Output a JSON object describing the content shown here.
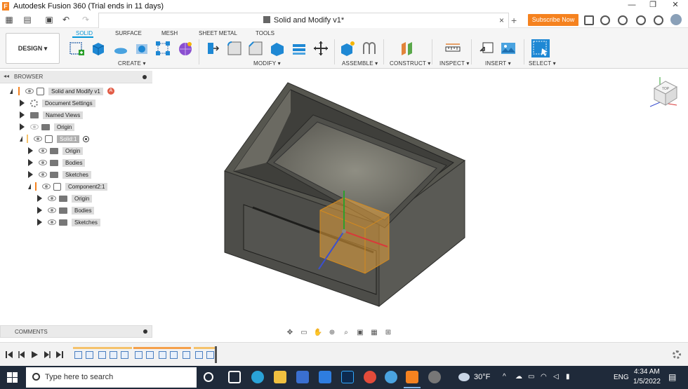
{
  "window": {
    "title": "Autodesk Fusion 360 (Trial ends in 11 days)",
    "logo_letter": "F",
    "minimize": "—",
    "restore": "❐",
    "close": "✕"
  },
  "document_tab": {
    "title": "Solid and Modify v1*",
    "close": "×",
    "new_tab": "+"
  },
  "header": {
    "subscribe_label": "Subscribe Now"
  },
  "toolbar": {
    "workspace": "DESIGN ▾",
    "tabs": [
      "SOLID",
      "SURFACE",
      "MESH",
      "SHEET METAL",
      "TOOLS"
    ],
    "groups": [
      "CREATE ▾",
      "MODIFY ▾",
      "ASSEMBLE ▾",
      "CONSTRUCT ▾",
      "INSPECT ▾",
      "INSERT ▾",
      "SELECT ▾"
    ]
  },
  "browser": {
    "title": "BROWSER",
    "items": [
      {
        "label": "Solid and Modify v1"
      },
      {
        "label": "Document Settings"
      },
      {
        "label": "Named Views"
      },
      {
        "label": "Origin"
      },
      {
        "label": "Solid:1"
      },
      {
        "label": "Origin"
      },
      {
        "label": "Bodies"
      },
      {
        "label": "Sketches"
      },
      {
        "label": "Component2:1"
      },
      {
        "label": "Origin"
      },
      {
        "label": "Bodies"
      },
      {
        "label": "Sketches"
      }
    ]
  },
  "comments": {
    "title": "COMMENTS"
  },
  "viewcube": {
    "face_label": "TOP"
  },
  "taskbar": {
    "search_placeholder": "Type here to search",
    "weather": "30°F",
    "language": "ENG",
    "time": "4:34 AM",
    "date": "1/5/2022"
  },
  "colors": {
    "accent": "#0696d7",
    "subscribe": "#f5821f",
    "model_body": "#5a5a55",
    "selection_highlight": "#e8a23a"
  }
}
